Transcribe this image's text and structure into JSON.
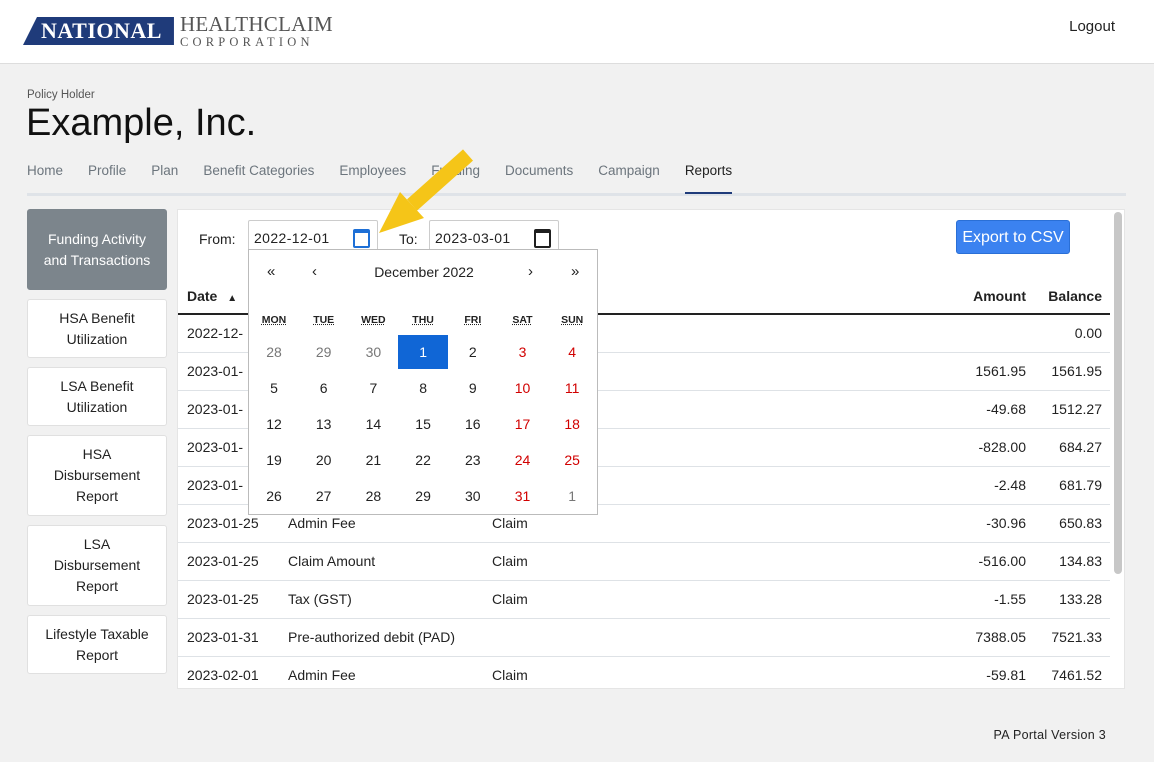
{
  "header": {
    "logo_primary": "NATIONAL",
    "logo_line1": "HEALTHCLAIM",
    "logo_line2": "CORPORATION",
    "logout": "Logout"
  },
  "policy": {
    "label": "Policy Holder",
    "name": "Example, Inc."
  },
  "nav": [
    "Home",
    "Profile",
    "Plan",
    "Benefit Categories",
    "Employees",
    "Funding",
    "Documents",
    "Campaign",
    "Reports"
  ],
  "nav_active": "Reports",
  "sidebar": [
    "Funding Activity and Transactions",
    "HSA Benefit Utilization",
    "LSA Benefit Utilization",
    "HSA Disbursement Report",
    "LSA Disbursement Report",
    "Lifestyle Taxable Report"
  ],
  "filters": {
    "from_label": "From:",
    "from_value": "2022-12-01",
    "to_label": "To:",
    "to_value": "2023-03-01",
    "export": "Export to CSV"
  },
  "table": {
    "headers": {
      "date": "Date",
      "amount": "Amount",
      "balance": "Balance"
    },
    "rows": [
      [
        "2022-12-",
        "",
        "",
        "",
        "0.00"
      ],
      [
        "2023-01-",
        "",
        "",
        "1561.95",
        "1561.95"
      ],
      [
        "2023-01-",
        "",
        "",
        "-49.68",
        "1512.27"
      ],
      [
        "2023-01-",
        "",
        "",
        "-828.00",
        "684.27"
      ],
      [
        "2023-01-",
        "",
        "",
        "-2.48",
        "681.79"
      ],
      [
        "2023-01-25",
        "Admin Fee",
        "Claim",
        "-30.96",
        "650.83"
      ],
      [
        "2023-01-25",
        "Claim Amount",
        "Claim",
        "-516.00",
        "134.83"
      ],
      [
        "2023-01-25",
        "Tax (GST)",
        "Claim",
        "-1.55",
        "133.28"
      ],
      [
        "2023-01-31",
        "Pre-authorized debit (PAD)",
        "",
        "7388.05",
        "7521.33"
      ],
      [
        "2023-02-01",
        "Admin Fee",
        "Claim",
        "-59.81",
        "7461.52"
      ]
    ]
  },
  "calendar": {
    "month_label": "December 2022",
    "nav": {
      "prev_year": "«",
      "prev_month": "‹",
      "next_month": "›",
      "next_year": "»"
    },
    "weekdays": [
      "MON",
      "TUE",
      "WED",
      "THU",
      "FRI",
      "SAT",
      "SUN"
    ],
    "weeks": [
      [
        "28",
        "29",
        "30",
        "1",
        "2",
        "3",
        "4"
      ],
      [
        "5",
        "6",
        "7",
        "8",
        "9",
        "10",
        "11"
      ],
      [
        "12",
        "13",
        "14",
        "15",
        "16",
        "17",
        "18"
      ],
      [
        "19",
        "20",
        "21",
        "22",
        "23",
        "24",
        "25"
      ],
      [
        "26",
        "27",
        "28",
        "29",
        "30",
        "31",
        "1"
      ]
    ],
    "selected": "1"
  },
  "colors": {
    "brand": "#1f3b7a",
    "accent": "#3b82f0",
    "selected_day": "#1066d6",
    "weekend": "#d10000",
    "annotation_arrow": "#f5c518"
  },
  "footer": "PA Portal Version 3"
}
